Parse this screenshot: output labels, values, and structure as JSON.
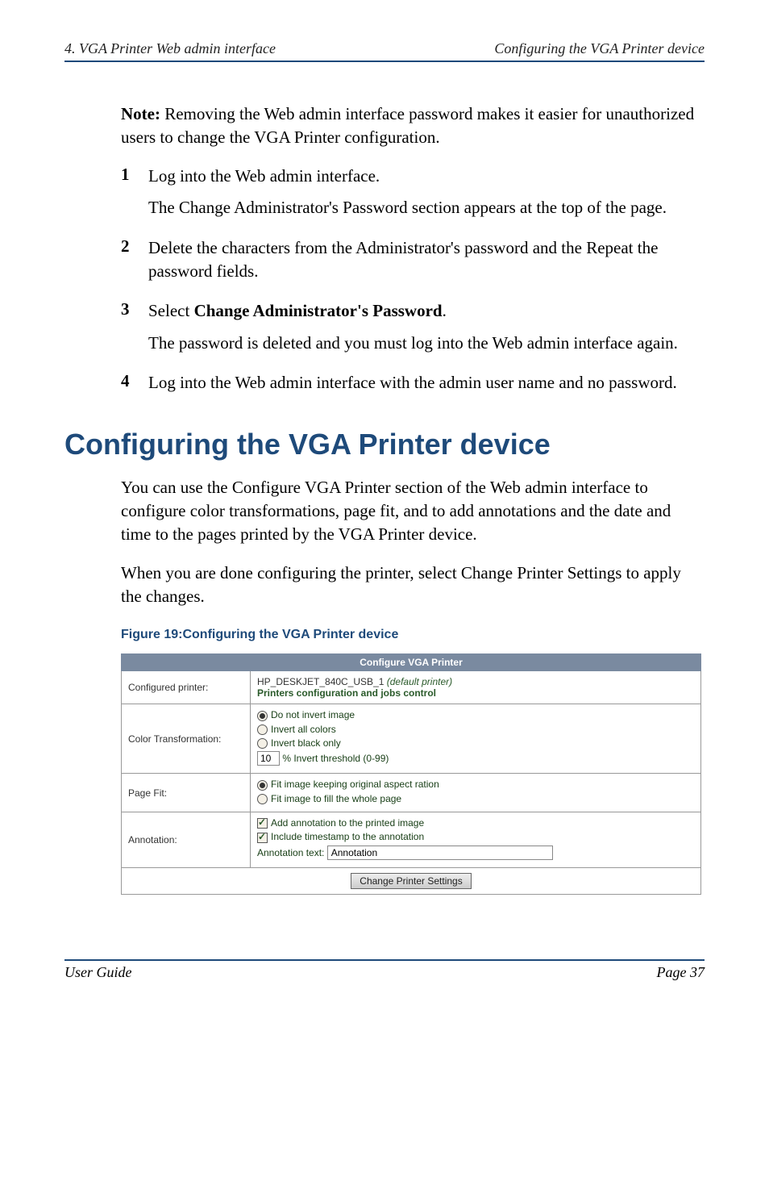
{
  "header": {
    "left": "4. VGA Printer Web admin interface",
    "right": "Configuring the VGA Printer device"
  },
  "note": {
    "label": "Note:",
    "text": " Removing the Web admin interface password makes it easier for unauthorized users to change the VGA Printer configuration."
  },
  "steps": {
    "s1": {
      "n": "1",
      "body": "Log into the Web admin interface.",
      "after": "The Change Administrator's Password section appears at the top of the page."
    },
    "s2": {
      "n": "2",
      "body": "Delete the characters from the Administrator's password and the Repeat the password fields."
    },
    "s3": {
      "n": "3",
      "lead": "Select ",
      "bold": "Change Administrator's Password",
      "tail": ".",
      "after": "The password is deleted and you must log into the Web admin interface again."
    },
    "s4": {
      "n": "4",
      "body": "Log into the Web admin interface with the admin user name and no password."
    }
  },
  "section_heading": "Configuring the VGA Printer device",
  "para1": "You can use the Configure VGA Printer section of the Web admin interface to configure color transformations, page fit, and to add annotations and the date and time to the pages printed by the VGA Printer device.",
  "para2": "When you are done configuring the printer, select Change Printer Settings to apply the changes.",
  "figure_caption": "Figure 19:Configuring the VGA Printer device",
  "table": {
    "title": "Configure VGA Printer",
    "rows": {
      "configured_printer": {
        "label": "Configured printer:",
        "value": "HP_DESKJET_840C_USB_1 ",
        "value_italic": "(default printer)",
        "link": "Printers configuration and jobs control"
      },
      "color_transformation": {
        "label": "Color Transformation:",
        "opt1": "Do not invert image",
        "opt2": "Invert all colors",
        "opt3": "Invert black only",
        "threshold_value": "10",
        "threshold_suffix": "% Invert threshold (0-99)"
      },
      "page_fit": {
        "label": "Page Fit:",
        "opt1": "Fit image keeping original aspect ration",
        "opt2": "Fit image to fill the whole page"
      },
      "annotation": {
        "label": "Annotation:",
        "cb1": "Add annotation to the printed image",
        "cb2": "Include timestamp to the annotation",
        "text_label": "Annotation text: ",
        "text_value": "Annotation"
      }
    },
    "button": "Change Printer Settings"
  },
  "footer": {
    "left": "User Guide",
    "right": "Page 37"
  }
}
